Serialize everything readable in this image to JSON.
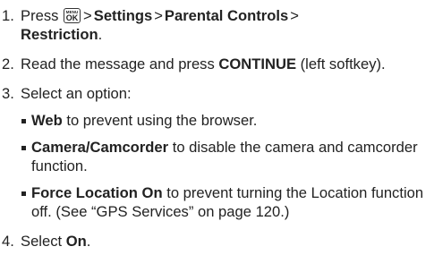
{
  "steps": [
    {
      "number": "1.",
      "prefix": "Press",
      "key_icon": {
        "name": "menu-ok-key-icon",
        "top": "MENU",
        "bottom": "OK"
      },
      "separator": ">",
      "path": [
        "Settings",
        "Parental Controls",
        "Restriction"
      ],
      "suffix": "."
    },
    {
      "number": "2.",
      "before": "Read the message and press ",
      "bold": "CONTINUE",
      "after": " (left softkey)."
    },
    {
      "number": "3.",
      "text": "Select an option:",
      "options": [
        {
          "bold": "Web",
          "text": " to prevent using the browser."
        },
        {
          "bold": "Camera/Camcorder",
          "text": " to disable the camera and camcorder function."
        },
        {
          "bold": "Force Location On",
          "text": " to prevent turning the Location function off. (See “GPS Services” on page 120.)"
        }
      ]
    },
    {
      "number": "4.",
      "before": "Select ",
      "bold": "On",
      "after": "."
    }
  ]
}
